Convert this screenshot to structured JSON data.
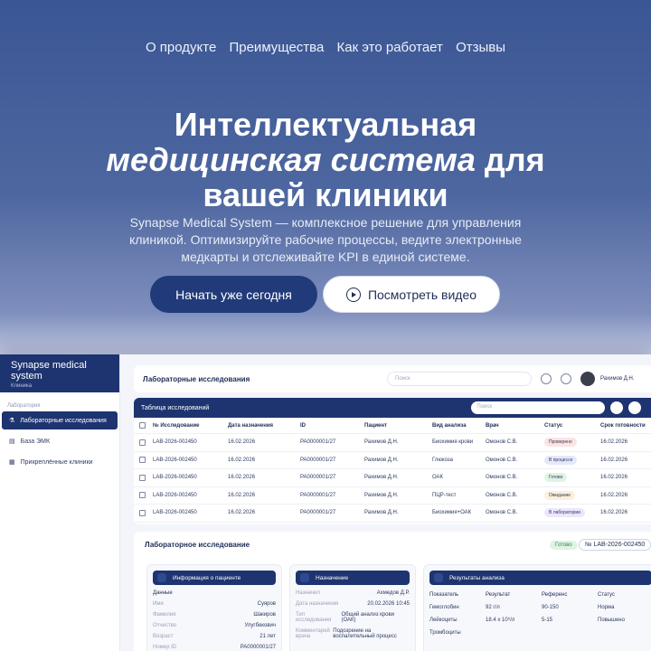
{
  "nav": {
    "items": [
      "О продукте",
      "Преимущества",
      "Как это работает",
      "Отзывы"
    ]
  },
  "hero": {
    "title_line1": "Интеллектуальная",
    "title_line2_italic": "медицинская система",
    "title_line2_rest": " для",
    "title_line3": "вашей клиники",
    "subtitle": "Synapse Medical System — комплексное решение для управления клиникой. Оптимизируйте рабочие процессы, ведите электронные медкарты и отслеживайте KPI в единой системе.",
    "cta_primary": "Начать уже сегодня",
    "cta_video": "Посмотреть видео"
  },
  "app": {
    "sidebar": {
      "title": "Synapse medical system",
      "subtitle": "Клиника",
      "group": "Лаборатория",
      "items": [
        "Лабораторные исследования",
        "База ЭМК",
        "Прикреплённые клиники"
      ]
    },
    "topbar": {
      "title": "Лабораторные исследования",
      "search_placeholder": "Поиск",
      "user": "Рахимов Д.Н."
    },
    "table": {
      "title": "Таблица исследований",
      "search_placeholder": "Поиск",
      "columns": [
        "№ Исследование",
        "Дата назначения",
        "ID",
        "Пациент",
        "Вид анализа",
        "Врач",
        "Статус",
        "Срок готовности"
      ],
      "rows": [
        [
          "LAB-2026-002450",
          "16.02.2026",
          "PA0000001/27",
          "Рахимов Д.Н.",
          "Биохимия крови",
          "Омонов С.В.",
          "Проверено",
          "16.02.2026"
        ],
        [
          "LAB-2026-002450",
          "16.02.2026",
          "PA0000001/27",
          "Рахимов Д.Н.",
          "Глюкоза",
          "Омонов С.В.",
          "В процессе",
          "16.02.2026"
        ],
        [
          "LAB-2026-002450",
          "16.02.2026",
          "PA0000001/27",
          "Рахимов Д.Н.",
          "ОАК",
          "Омонов С.В.",
          "Готово",
          "16.02.2026"
        ],
        [
          "LAB-2026-002450",
          "16.02.2026",
          "PA0000001/27",
          "Рахимов Д.Н.",
          "ПЦР-тест",
          "Омонов С.В.",
          "Ожидание",
          "16.02.2026"
        ],
        [
          "LAB-2026-002450",
          "16.02.2026",
          "PA0000001/27",
          "Рахимов Д.Н.",
          "Биохимия+ОАК",
          "Омонов С.В.",
          "В лаборатории",
          "16.02.2026"
        ]
      ],
      "status_colors": [
        "#fde3e3",
        "#e6e8fb",
        "#e0f3e4",
        "#fdf0d8",
        "#ece6fb"
      ]
    },
    "detail": {
      "title": "Лабораторное исследование",
      "status": "Готово",
      "number": "№ LAB-2026-002450",
      "patient": {
        "title": "Информация о пациенте",
        "section": "Данные",
        "fields": [
          [
            "Имя",
            "Суяров"
          ],
          [
            "Фамилия",
            "Шакиров"
          ],
          [
            "Отчество",
            "Улугбекович"
          ],
          [
            "Возраст",
            "21 лет"
          ],
          [
            "Номер ID",
            "PA0000001/27"
          ]
        ]
      },
      "assign": {
        "title": "Назначение",
        "fields": [
          [
            "Назначил",
            "Ахмедов Д.Р."
          ],
          [
            "Дата назначения",
            "20.02.2026 10:45"
          ],
          [
            "Тип исследования",
            "Общий анализ крови (ОАК)"
          ],
          [
            "Комментарий врача",
            "Подозрение на воспалительный процесс"
          ]
        ]
      },
      "results": {
        "title": "Результаты анализа",
        "headers": [
          "Показатель",
          "Результат",
          "Референс",
          "Статус"
        ],
        "rows": [
          [
            "Гемоглобин",
            "92 г/л",
            "90-150",
            "Норма"
          ],
          [
            "Лейкоциты",
            "18.4 x 10⁹/л",
            "5-15",
            "Повышено"
          ],
          [
            "Тромбоциты",
            "",
            "",
            ""
          ]
        ]
      }
    }
  }
}
